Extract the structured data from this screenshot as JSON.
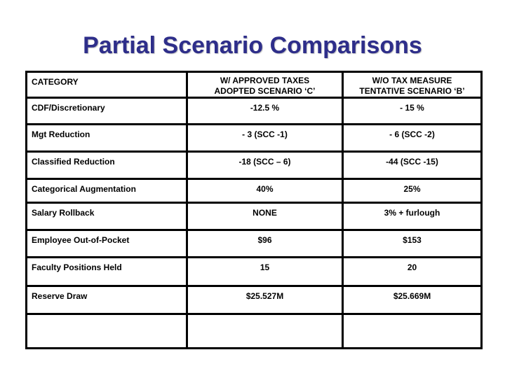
{
  "slide": {
    "title": "Partial Scenario Comparisons",
    "title_color": "#2e2e8a"
  },
  "table": {
    "headers": {
      "category": "CATEGORY",
      "scenario_c_line1": "W/ APPROVED TAXES",
      "scenario_c_line2": "ADOPTED SCENARIO ‘C’",
      "scenario_b_line1": "W/O TAX MEASURE",
      "scenario_b_line2": "TENTATIVE SCENARIO ‘B’"
    },
    "rows": [
      {
        "category": "CDF/Discretionary",
        "scenario_c": "-12.5 %",
        "scenario_b": "- 15 %"
      },
      {
        "category": "Mgt Reduction",
        "scenario_c": "- 3 (SCC -1)",
        "scenario_b": "- 6 (SCC -2)"
      },
      {
        "category": "Classified Reduction",
        "scenario_c": "-18 (SCC – 6)",
        "scenario_b": "-44 (SCC -15)"
      },
      {
        "category": "Categorical Augmentation",
        "scenario_c": "40%",
        "scenario_b": "25%"
      },
      {
        "category": "Salary Rollback",
        "scenario_c": "NONE",
        "scenario_b": "3% + furlough"
      },
      {
        "category": "Employee Out-of-Pocket",
        "scenario_c": "$96",
        "scenario_b": "$153"
      },
      {
        "category": "Faculty Positions Held",
        "scenario_c": "15",
        "scenario_b": "20"
      },
      {
        "category": "Reserve Draw",
        "scenario_c": "$25.527M",
        "scenario_b": "$25.669M"
      },
      {
        "category": "",
        "scenario_c": "",
        "scenario_b": ""
      }
    ]
  }
}
